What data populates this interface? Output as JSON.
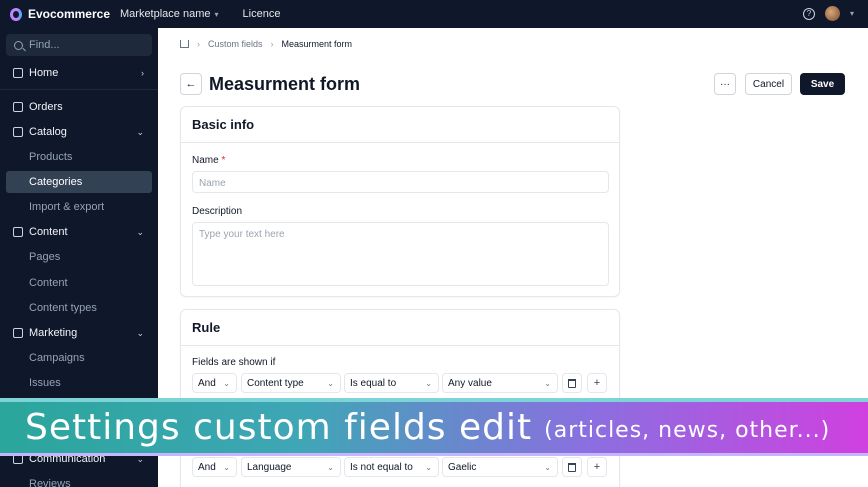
{
  "topbar": {
    "brand": "Evocommerce",
    "marketplace": "Marketplace name",
    "licence": "Licence"
  },
  "sidebar": {
    "search_placeholder": "Find...",
    "items": [
      {
        "label": "Home"
      },
      {
        "label": "Orders"
      },
      {
        "label": "Catalog"
      },
      {
        "label": "Products"
      },
      {
        "label": "Categories"
      },
      {
        "label": "Import & export"
      },
      {
        "label": "Content"
      },
      {
        "label": "Pages"
      },
      {
        "label": "Content"
      },
      {
        "label": "Content types"
      },
      {
        "label": "Marketing"
      },
      {
        "label": "Campaigns"
      },
      {
        "label": "Issues"
      },
      {
        "label": "Communication"
      },
      {
        "label": "Reviews"
      }
    ]
  },
  "breadcrumb": {
    "parent": "Custom fields",
    "current": "Measurment form"
  },
  "header": {
    "title": "Measurment form",
    "more_label": "···",
    "cancel_label": "Cancel",
    "save_label": "Save"
  },
  "basic_info": {
    "title": "Basic info",
    "name_label": "Name",
    "name_required": "*",
    "name_placeholder": "Name",
    "description_label": "Description",
    "description_placeholder": "Type your text here"
  },
  "rule": {
    "title": "Rule",
    "subtitle": "Fields are shown if",
    "rows": [
      {
        "connector": "And",
        "field": "Content type",
        "operator": "Is equal to",
        "value": "Any value"
      },
      {
        "connector": "And",
        "field": "Language",
        "operator": "Is not equal to",
        "value": "Gaelic"
      }
    ]
  },
  "banner": {
    "main": "Settings custom fields edit",
    "sub": "(articles, news, other...)"
  }
}
